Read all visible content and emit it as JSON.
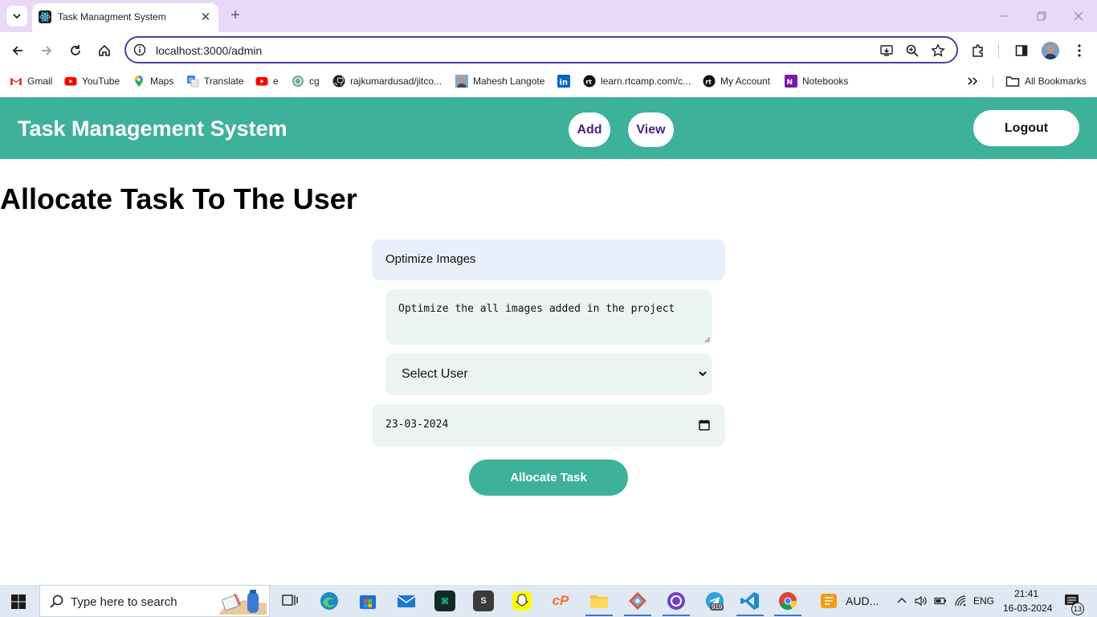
{
  "browser": {
    "tab": {
      "title": "Task Managment System"
    },
    "omnibox": {
      "url": "localhost:3000/admin"
    },
    "bookmarks": [
      {
        "label": "Gmail",
        "icon": "gmail-icon"
      },
      {
        "label": "YouTube",
        "icon": "youtube-icon"
      },
      {
        "label": "Maps",
        "icon": "maps-icon"
      },
      {
        "label": "Translate",
        "icon": "translate-icon"
      },
      {
        "label": "e",
        "icon": "youtube-icon"
      },
      {
        "label": "cg",
        "icon": "chatgpt-icon"
      },
      {
        "label": "rajkumardusad/jitco...",
        "icon": "github-icon"
      },
      {
        "label": "Mahesh Langote",
        "icon": "avatar-icon"
      },
      {
        "label": "",
        "icon": "linkedin-icon"
      },
      {
        "label": "learn.rtcamp.com/c...",
        "icon": "rtcamp-icon"
      },
      {
        "label": "My Account",
        "icon": "rtcamp-icon"
      },
      {
        "label": "Notebooks",
        "icon": "onenote-icon"
      }
    ],
    "all_bookmarks": "All Bookmarks"
  },
  "app": {
    "title": "Task Management System",
    "nav": {
      "add": "Add",
      "view": "View",
      "logout": "Logout"
    }
  },
  "form": {
    "heading": "Allocate Task To The User",
    "task_title": "Optimize Images",
    "description": "Optimize the all images added in the project",
    "user_select": "Select User",
    "due_date": "23-03-2024",
    "submit": "Allocate Task"
  },
  "taskbar": {
    "search_placeholder": "Type here to search",
    "audio_label": "AUD...",
    "language": "ENG",
    "time": "21:41",
    "date": "16-03-2024",
    "notifications": "13",
    "telegram_badge": "919"
  },
  "colors": {
    "accent": "#3eb19a",
    "nav_text": "#4b2386",
    "omnibox_border": "#5b3aa0",
    "titlebar": "#e9d8f8"
  }
}
